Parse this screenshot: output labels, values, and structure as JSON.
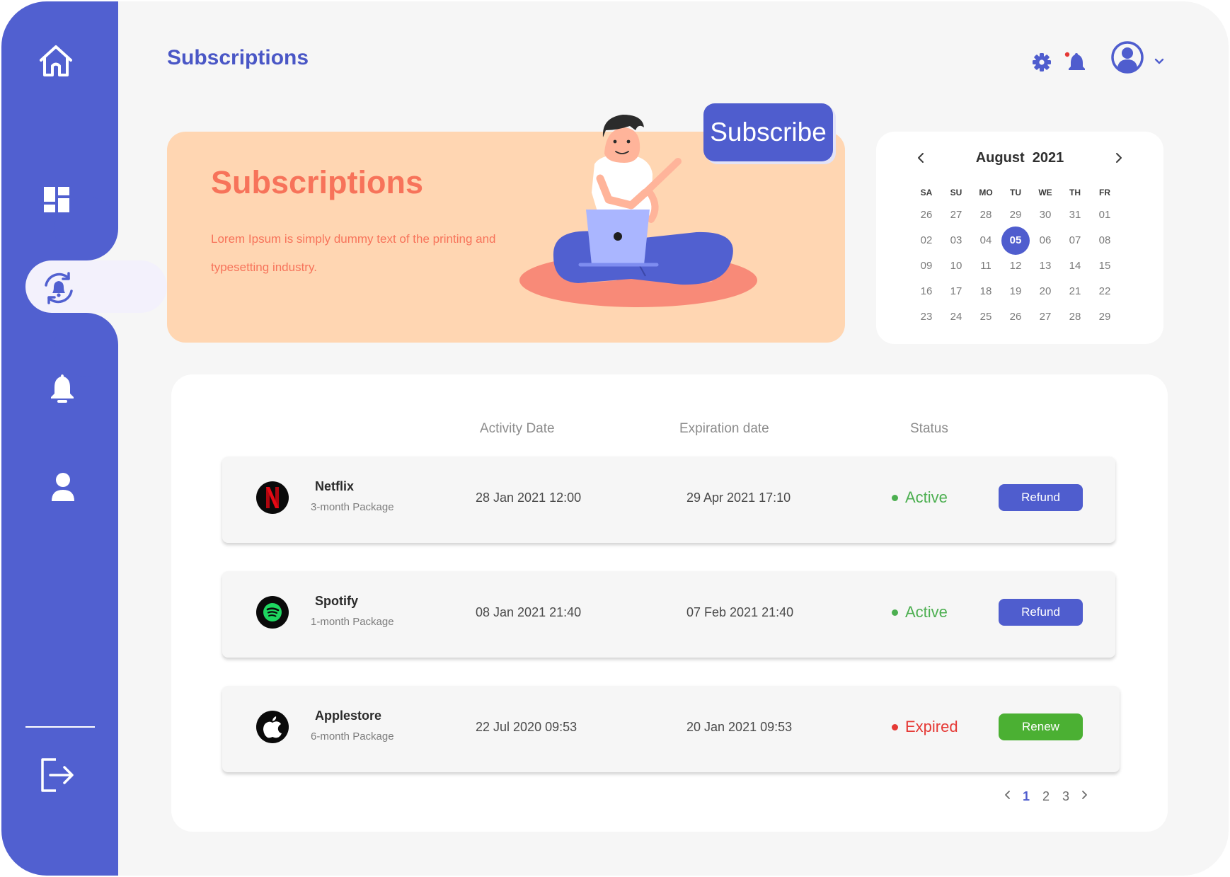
{
  "header": {
    "title": "Subscriptions"
  },
  "hero": {
    "title": "Subscriptions",
    "text": "Lorem Ipsum is simply dummy text of the printing and typesetting industry.",
    "button_label": "Subscribe"
  },
  "calendar": {
    "month": "August",
    "year": "2021",
    "weekdays": [
      "SA",
      "SU",
      "MO",
      "TU",
      "WE",
      "TH",
      "FR"
    ],
    "days": [
      "26",
      "27",
      "28",
      "29",
      "30",
      "31",
      "01",
      "02",
      "03",
      "04",
      "05",
      "06",
      "07",
      "08",
      "09",
      "10",
      "11",
      "12",
      "13",
      "14",
      "15",
      "16",
      "17",
      "18",
      "19",
      "20",
      "21",
      "22",
      "23",
      "24",
      "25",
      "26",
      "27",
      "28",
      "29"
    ],
    "selected": "05"
  },
  "table": {
    "columns": {
      "activity": "Activity Date",
      "expiration": "Expiration date",
      "status": "Status"
    },
    "rows": [
      {
        "name": "Netflix",
        "package": "3-month Package",
        "activity": "28 Jan 2021 12:00",
        "expiration": "29 Apr 2021 17:10",
        "status": "Active",
        "action": "Refund"
      },
      {
        "name": "Spotify",
        "package": "1-month Package",
        "activity": "08 Jan 2021 21:40",
        "expiration": "07 Feb 2021 21:40",
        "status": "Active",
        "action": "Refund"
      },
      {
        "name": "Applestore",
        "package": "6-month Package",
        "activity": "22 Jul 2020 09:53",
        "expiration": "20 Jan 2021 09:53",
        "status": "Expired",
        "action": "Renew"
      }
    ]
  },
  "pagination": {
    "pages": [
      "1",
      "2",
      "3"
    ],
    "current": "1"
  },
  "colors": {
    "sidebar": "#5160d0",
    "accent": "#4f5dce",
    "hero_bg": "#ffd6b2",
    "hero_text": "#f7735a",
    "active": "#4caf50",
    "expired": "#e53935",
    "renew": "#4bb033"
  },
  "icons": {
    "sidebar": [
      "home-icon",
      "dashboard-icon",
      "subscription-refresh-icon",
      "bell-icon",
      "user-icon",
      "logout-icon"
    ],
    "topbar": [
      "gear-icon",
      "notification-bell-icon",
      "user-avatar-icon",
      "chevron-down-icon"
    ]
  }
}
